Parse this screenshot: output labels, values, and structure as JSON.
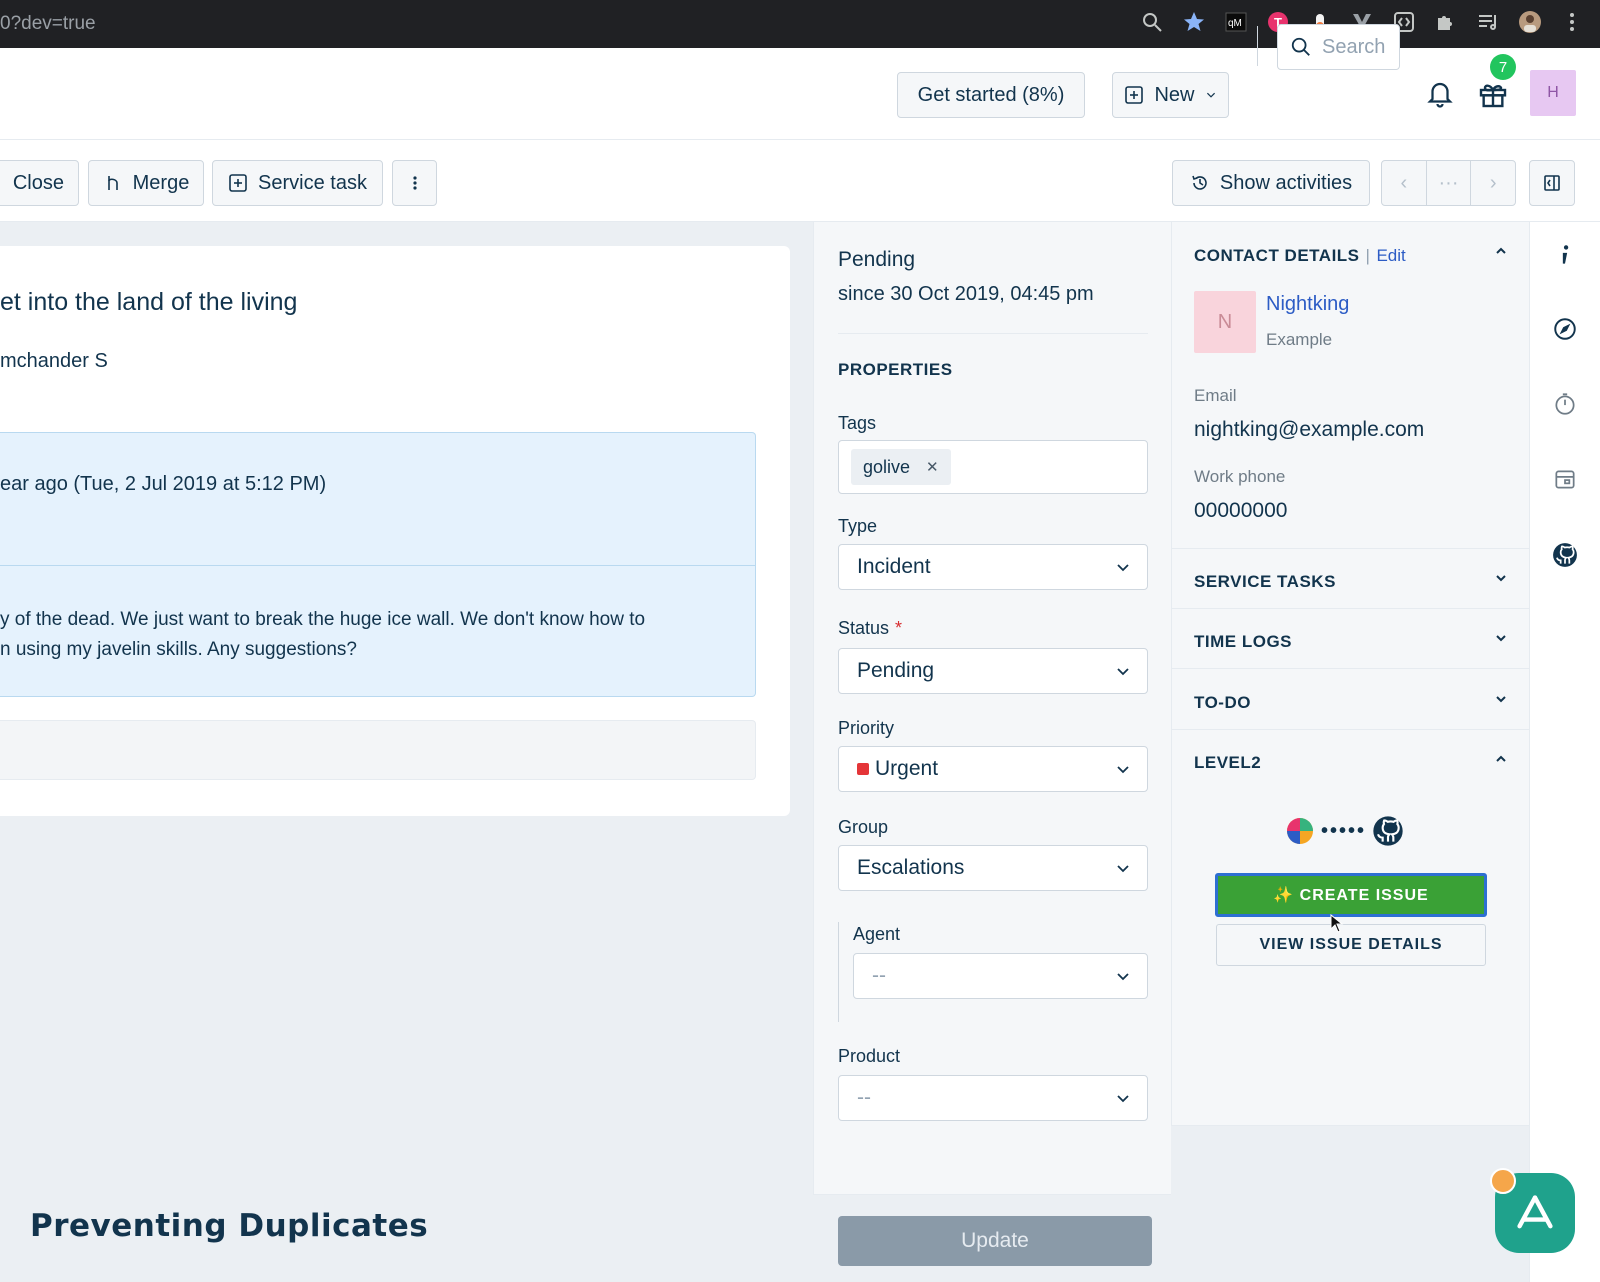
{
  "browser": {
    "url": "0?dev=true",
    "icons": [
      "zoom-icon",
      "star-icon",
      "qm-extension-icon",
      "t-extension-icon",
      "pill-extension-icon",
      "v-extension-icon",
      "code-extension-icon",
      "puzzle-icon",
      "queue-icon",
      "profile-avatar",
      "kebab-menu-icon"
    ]
  },
  "header": {
    "get_started": "Get started (8%)",
    "new_label": "New",
    "search_placeholder": "Search",
    "gift_badge": "7",
    "avatar_initial": "H"
  },
  "toolbar": {
    "close": "Close",
    "merge": "Merge",
    "service_task": "Service task",
    "show_activities": "Show activities",
    "nav_prev": "‹",
    "nav_more": "···",
    "nav_next": "›"
  },
  "ticket": {
    "title": "et into the land of the living",
    "requester": "mchander S",
    "message_time": "ear ago (Tue, 2 Jul 2019 at 5:12 PM)",
    "message_body_line1": "y of the dead. We just want to break the huge ice wall. We don't know how to",
    "message_body_line2": "n using my javelin skills. Any suggestions?"
  },
  "status_block": {
    "status": "Pending",
    "since": "since 30 Oct 2019, 04:45 pm"
  },
  "properties": {
    "heading": "PROPERTIES",
    "tags_label": "Tags",
    "tags": [
      "golive"
    ],
    "tag_remove": "✕",
    "type_label": "Type",
    "type_value": "Incident",
    "status_label": "Status",
    "status_required": "*",
    "status_value": "Pending",
    "priority_label": "Priority",
    "priority_value": "Urgent",
    "priority_color": "#e43538",
    "group_label": "Group",
    "group_value": "Escalations",
    "agent_label": "Agent",
    "agent_value": "--",
    "product_label": "Product",
    "product_value": "--",
    "update": "Update"
  },
  "contact": {
    "heading": "CONTACT DETAILS",
    "edit": "Edit",
    "avatar_initial": "N",
    "name": "Nightking",
    "company": "Example",
    "email_label": "Email",
    "email": "nightking@example.com",
    "phone_label": "Work phone",
    "phone": "00000000"
  },
  "accordions": {
    "service_tasks": "SERVICE TASKS",
    "time_logs": "TIME LOGS",
    "todo": "TO-DO",
    "level2": "LEVEL2"
  },
  "level2": {
    "dots": "•••••",
    "create_issue": "✨ CREATE ISSUE",
    "view_issue": "VIEW ISSUE DETAILS"
  },
  "caption": "Preventing Duplicates",
  "colors": {
    "accent_link": "#2c5cc5",
    "create_issue_bg": "#3aa136",
    "fab_bg": "#1fa28c",
    "badge_bg": "#22c55e"
  }
}
